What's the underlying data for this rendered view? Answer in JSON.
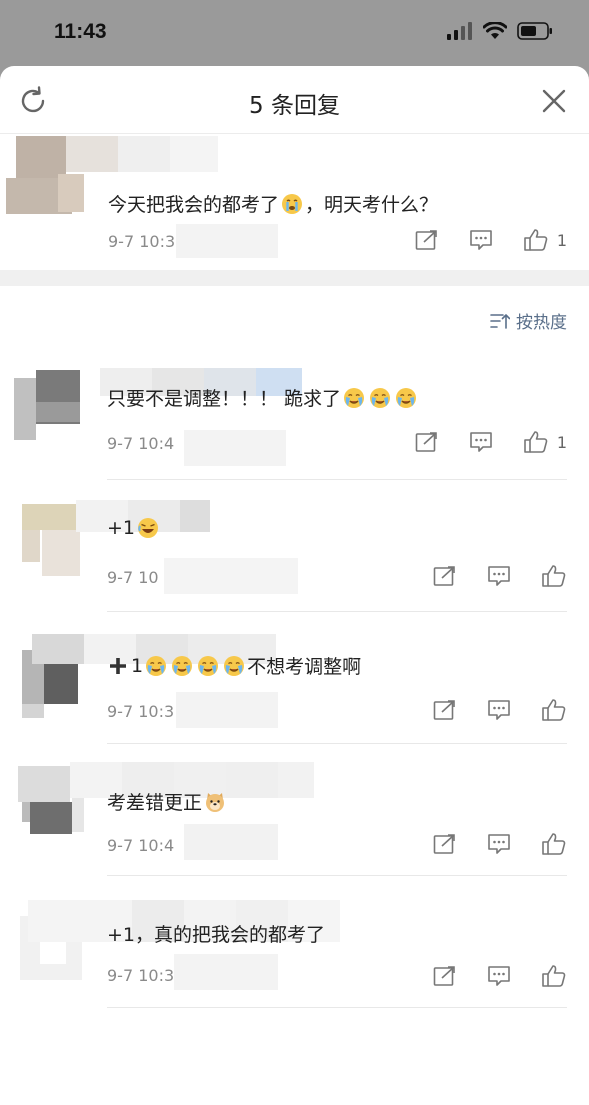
{
  "status": {
    "time": "11:43"
  },
  "header": {
    "title": "5 条回复"
  },
  "main_comment": {
    "text_before": "今天把我会的都考了",
    "text_after": "，明天考什么？",
    "time": "9-7 10:3",
    "likes": "1"
  },
  "sort": {
    "label": "按热度"
  },
  "replies": [
    {
      "text_before": "只要不是调整！！！ 跪求了",
      "text_after": "",
      "emoji_count": 3,
      "emoji_kind": "tears",
      "time": "9-7 10:4",
      "likes": "1"
    },
    {
      "text_before": "+1",
      "text_after": "",
      "emoji_count": 1,
      "emoji_kind": "laugh",
      "time": "9-7 10",
      "likes": ""
    },
    {
      "text_before": "1",
      "text_after": "不想考调整啊",
      "emoji_count": 4,
      "emoji_kind": "tears",
      "time": "9-7 10:3",
      "likes": ""
    },
    {
      "text_before": "考差错更正",
      "text_after": "",
      "emoji_count": 1,
      "emoji_kind": "doge",
      "time": "9-7 10:4",
      "likes": ""
    },
    {
      "text_before": "+1，真的把我会的都考了",
      "text_after": "",
      "emoji_count": 0,
      "emoji_kind": "",
      "time": "9-7 10:3",
      "likes": ""
    }
  ]
}
